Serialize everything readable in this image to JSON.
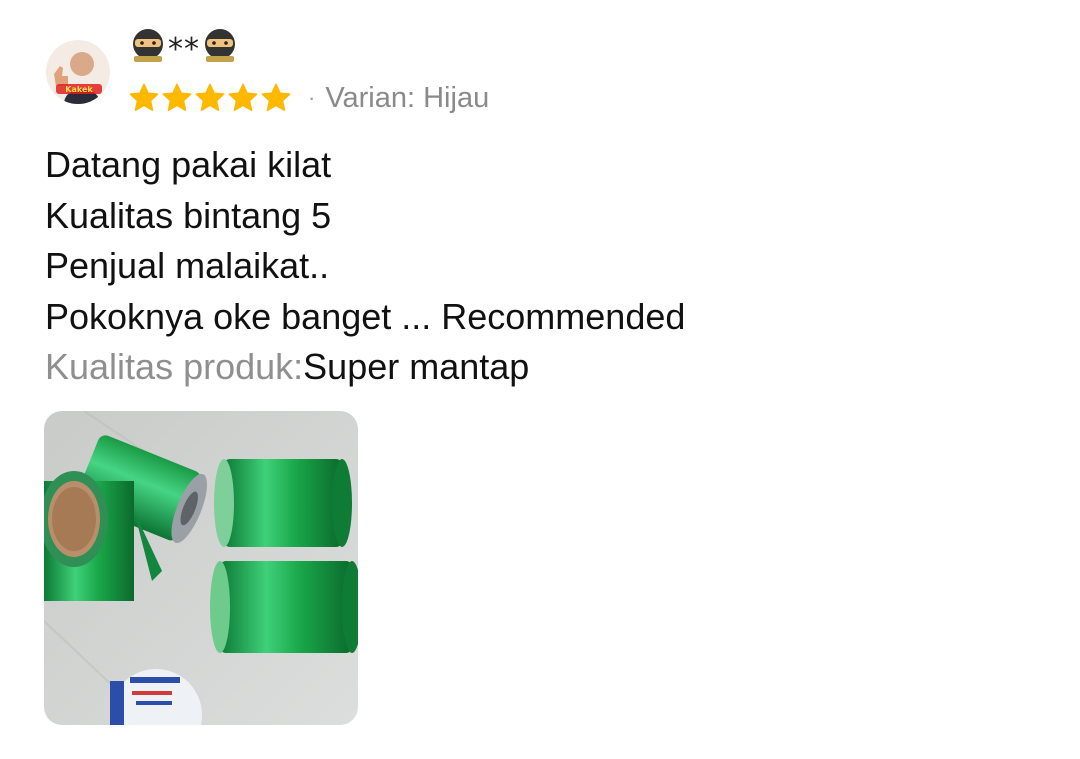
{
  "review": {
    "avatar_icon": "user-avatar-thumbs-up",
    "avatar_caption": "Kakek",
    "username": {
      "prefix_icon": "ninja-emoji",
      "masked": "**",
      "suffix_icon": "ninja-emoji"
    },
    "rating": 5,
    "rating_max": 5,
    "star_color": "#FFB800",
    "separator": "·",
    "variant": "Varian: Hijau",
    "body_lines": [
      "Datang pakai kilat",
      "Kualitas bintang 5",
      "Penjual malaikat..",
      "Pokoknya oke banget ... Recommended"
    ],
    "quality": {
      "label": "Kualitas produk:",
      "value": "Super mantap"
    },
    "photo": {
      "icon": "product-photo",
      "subject_color": "#1FA84A"
    }
  }
}
